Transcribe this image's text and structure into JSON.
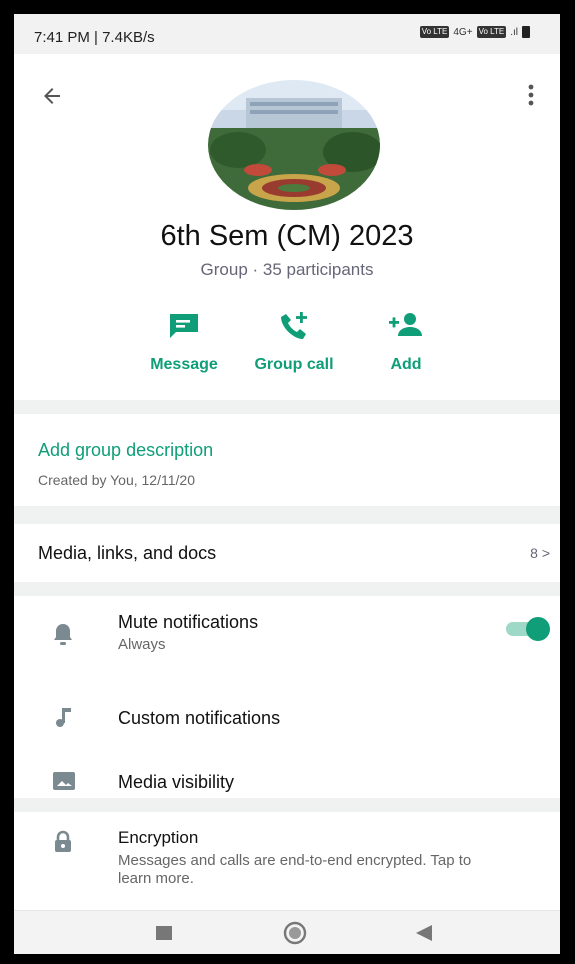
{
  "status_bar": {
    "time": "7:41 PM | 7.4KB/s",
    "icons": [
      "volte-icon",
      "4g-signal-icon",
      "volte-icon",
      "signal-icon",
      "battery-icon"
    ],
    "volte_label": "Vo LTE",
    "net_label": "4G+",
    "signal_label": ".ıl"
  },
  "header": {
    "back_icon": "arrow-left-icon",
    "menu_icon": "more-vert-icon",
    "group_name": "6th Sem (CM) 2023",
    "subtitle": "Group · 35 participants",
    "actions": [
      {
        "label": "Message",
        "icon": "message-icon"
      },
      {
        "label": "Group call",
        "icon": "group-call-icon"
      },
      {
        "label": "Add",
        "icon": "add-person-icon"
      }
    ]
  },
  "description": {
    "add_label": "Add group description",
    "created": "Created by You, 12/11/20"
  },
  "media": {
    "label": "Media, links, and docs",
    "count": "8 >"
  },
  "settings": [
    {
      "label": "Mute notifications",
      "sub": "Always",
      "icon": "bell-icon",
      "toggle": true
    },
    {
      "label": "Custom notifications",
      "icon": "music-note-icon"
    },
    {
      "label": "Media visibility",
      "icon": "image-icon"
    }
  ],
  "encryption": {
    "label": "Encryption",
    "sub": "Messages and calls are end-to-end encrypted. Tap to learn more.",
    "icon": "lock-icon"
  },
  "nav_bar": {
    "icons": [
      "recents-icon",
      "home-icon",
      "back-triangle-icon"
    ]
  },
  "colors": {
    "accent": "#0f9e78",
    "toggle_track": "#9ed8c7",
    "separator": "#f0f2f2"
  }
}
